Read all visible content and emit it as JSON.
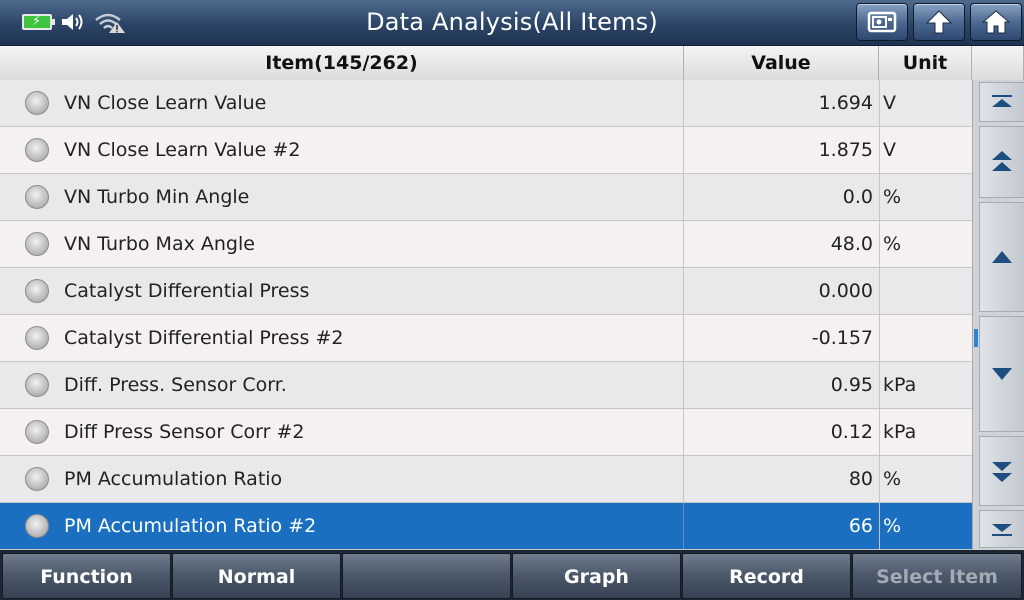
{
  "title": "Data Analysis(All Items)",
  "status": {
    "icons": [
      "battery-charging-icon",
      "speaker-icon",
      "wifi-warning-icon"
    ]
  },
  "toolbar": {
    "buttons": [
      "screenshot-icon",
      "back-icon",
      "home-icon"
    ]
  },
  "table": {
    "headers": {
      "item": "Item(145/262)",
      "value": "Value",
      "unit": "Unit"
    },
    "rows": [
      {
        "name": "VN Close Learn Value",
        "value": "1.694",
        "unit": "V"
      },
      {
        "name": "VN Close Learn Value #2",
        "value": "1.875",
        "unit": "V"
      },
      {
        "name": "VN Turbo Min Angle",
        "value": "0.0",
        "unit": "%"
      },
      {
        "name": "VN Turbo Max Angle",
        "value": "48.0",
        "unit": "%"
      },
      {
        "name": "Catalyst Differential Press",
        "value": "0.000",
        "unit": ""
      },
      {
        "name": "Catalyst Differential Press #2",
        "value": "-0.157",
        "unit": ""
      },
      {
        "name": "Diff. Press. Sensor Corr.",
        "value": "0.95",
        "unit": "kPa"
      },
      {
        "name": "Diff Press Sensor Corr #2",
        "value": "0.12",
        "unit": "kPa"
      },
      {
        "name": "PM Accumulation Ratio",
        "value": "80",
        "unit": "%"
      },
      {
        "name": "PM Accumulation Ratio #2",
        "value": "66",
        "unit": "%"
      }
    ],
    "selected_row": 9
  },
  "scroll_position": 0.55,
  "bottom": {
    "function": "Function",
    "normal": "Normal",
    "blank": "",
    "graph": "Graph",
    "record": "Record",
    "select_item": "Select Item"
  },
  "colors": {
    "selected_row": "#1a6fc0",
    "title_bar": "#2c4466"
  }
}
